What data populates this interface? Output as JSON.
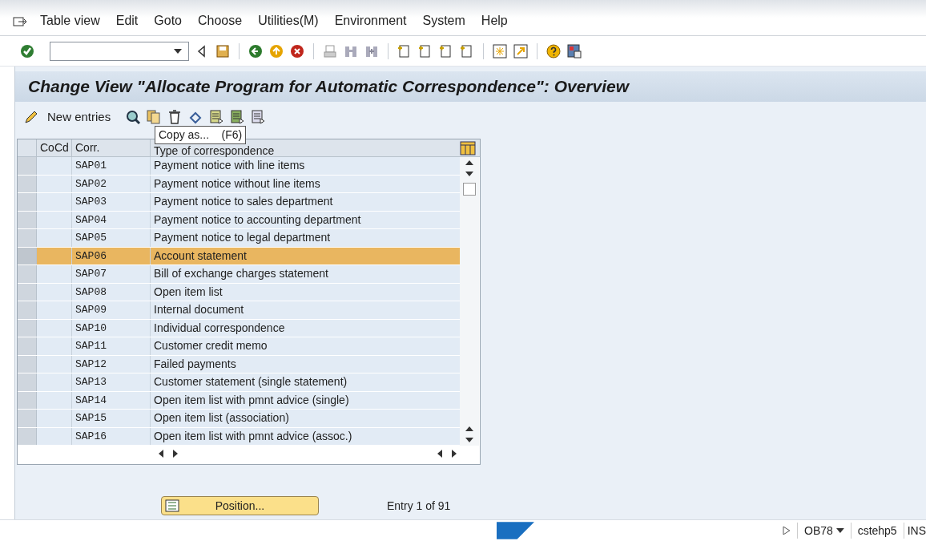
{
  "menu": [
    {
      "label": "Table view"
    },
    {
      "label": "Edit"
    },
    {
      "label": "Goto"
    },
    {
      "label": "Choose"
    },
    {
      "label": "Utilities(M)"
    },
    {
      "label": "Environment"
    },
    {
      "label": "System"
    },
    {
      "label": "Help"
    }
  ],
  "title": "Change View \"Allocate Program for Automatic Correspondence\": Overview",
  "app_toolbar": {
    "new_entries": "New entries",
    "tooltip": "Copy as...    (F6)"
  },
  "table": {
    "columns": [
      "CoCd",
      "Corr.",
      "Type of correspondence"
    ],
    "rows": [
      {
        "code": "SAP01",
        "text": "Payment notice with line items",
        "selected": false
      },
      {
        "code": "SAP02",
        "text": "Payment notice without line items",
        "selected": false
      },
      {
        "code": "SAP03",
        "text": "Payment notice to sales department",
        "selected": false
      },
      {
        "code": "SAP04",
        "text": "Payment notice to accounting department",
        "selected": false
      },
      {
        "code": "SAP05",
        "text": "Payment notice to legal department",
        "selected": false
      },
      {
        "code": "SAP06",
        "text": "Account statement",
        "selected": true
      },
      {
        "code": "SAP07",
        "text": "Bill of exchange charges statement",
        "selected": false
      },
      {
        "code": "SAP08",
        "text": "Open item list",
        "selected": false
      },
      {
        "code": "SAP09",
        "text": "Internal document",
        "selected": false
      },
      {
        "code": "SAP10",
        "text": "Individual correspondence",
        "selected": false
      },
      {
        "code": "SAP11",
        "text": "Customer credit memo",
        "selected": false
      },
      {
        "code": "SAP12",
        "text": "Failed payments",
        "selected": false
      },
      {
        "code": "SAP13",
        "text": "Customer statement (single statement)",
        "selected": false
      },
      {
        "code": "SAP14",
        "text": "Open item list with pmnt advice (single)",
        "selected": false
      },
      {
        "code": "SAP15",
        "text": "Open item list (association)",
        "selected": false
      },
      {
        "code": "SAP16",
        "text": "Open item list with pmnt advice (assoc.)",
        "selected": false
      }
    ]
  },
  "position_button": "Position...",
  "entry_count": "Entry 1 of 91",
  "status_bar": {
    "transaction": "OB78",
    "server": "cstehp5",
    "mode": "INS"
  }
}
